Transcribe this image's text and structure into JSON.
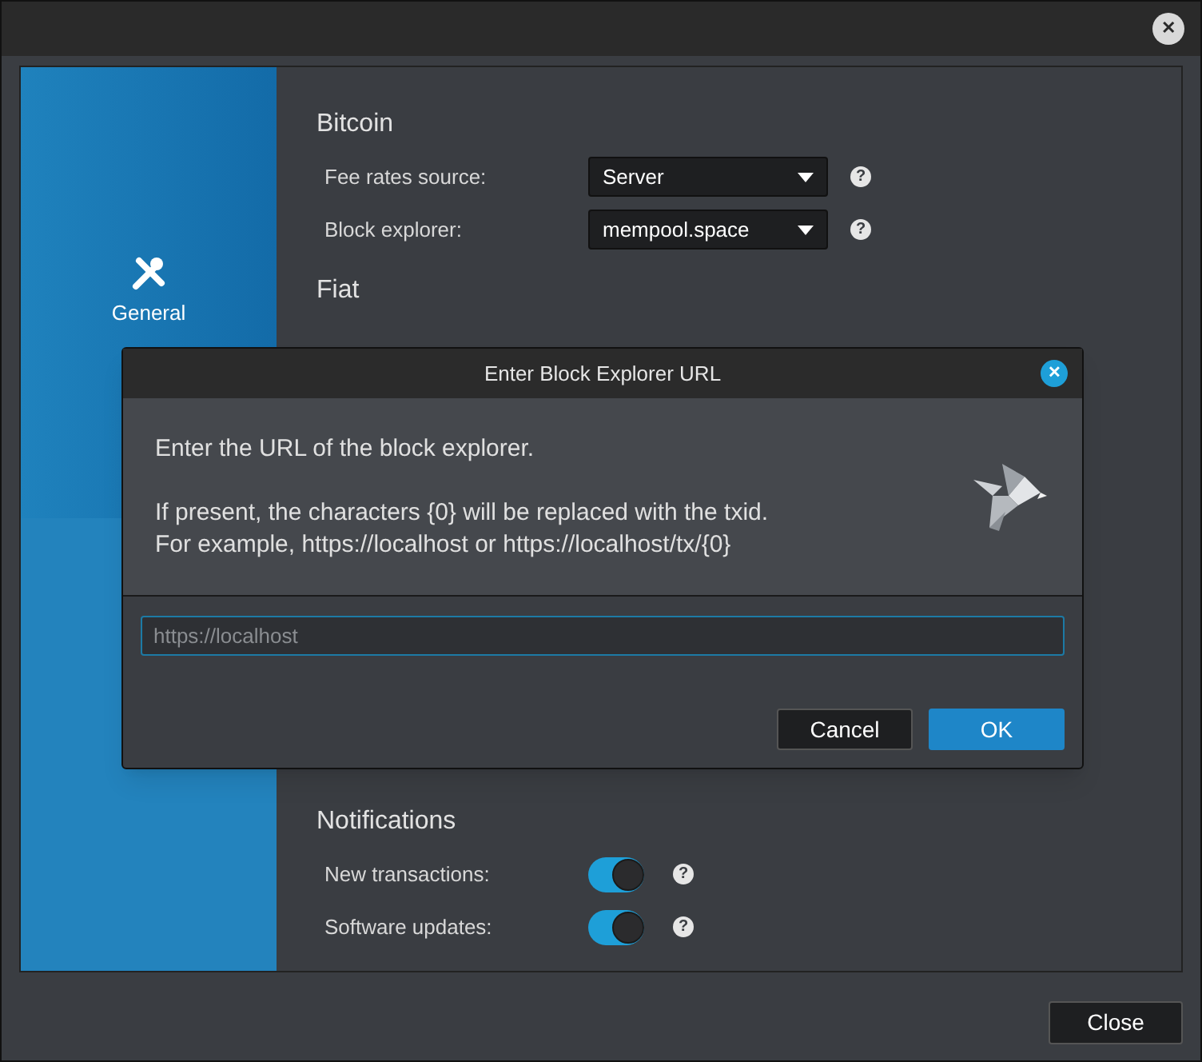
{
  "window": {
    "close": "✕"
  },
  "sidebar": {
    "items": [
      {
        "label": "General",
        "selected": true
      }
    ]
  },
  "sections": [
    {
      "title": "Bitcoin",
      "rows": [
        {
          "kind": "select",
          "label": "Fee rates source:",
          "value": "Server",
          "help": "?"
        },
        {
          "kind": "select",
          "label": "Block explorer:",
          "value": "mempool.space",
          "help": "?"
        }
      ]
    },
    {
      "title": "Fiat"
    },
    {
      "title": "Notifications",
      "rows": [
        {
          "kind": "toggle",
          "label": "New transactions:",
          "on": true,
          "help": "?"
        },
        {
          "kind": "toggle",
          "label": "Software updates:",
          "on": true,
          "help": "?"
        }
      ]
    }
  ],
  "dialog": {
    "title": "Enter Block Explorer URL",
    "close": "✕",
    "message": [
      "Enter the URL of the block explorer.",
      "If present, the characters {0} will be replaced with the txid.",
      "For example, https://localhost or https://localhost/tx/{0}"
    ],
    "input": {
      "placeholder": "https://localhost"
    },
    "buttons": [
      {
        "label": "Cancel",
        "kind": "secondary"
      },
      {
        "label": "OK",
        "kind": "primary"
      }
    ]
  },
  "footer": {
    "buttons": [
      "Close"
    ]
  }
}
